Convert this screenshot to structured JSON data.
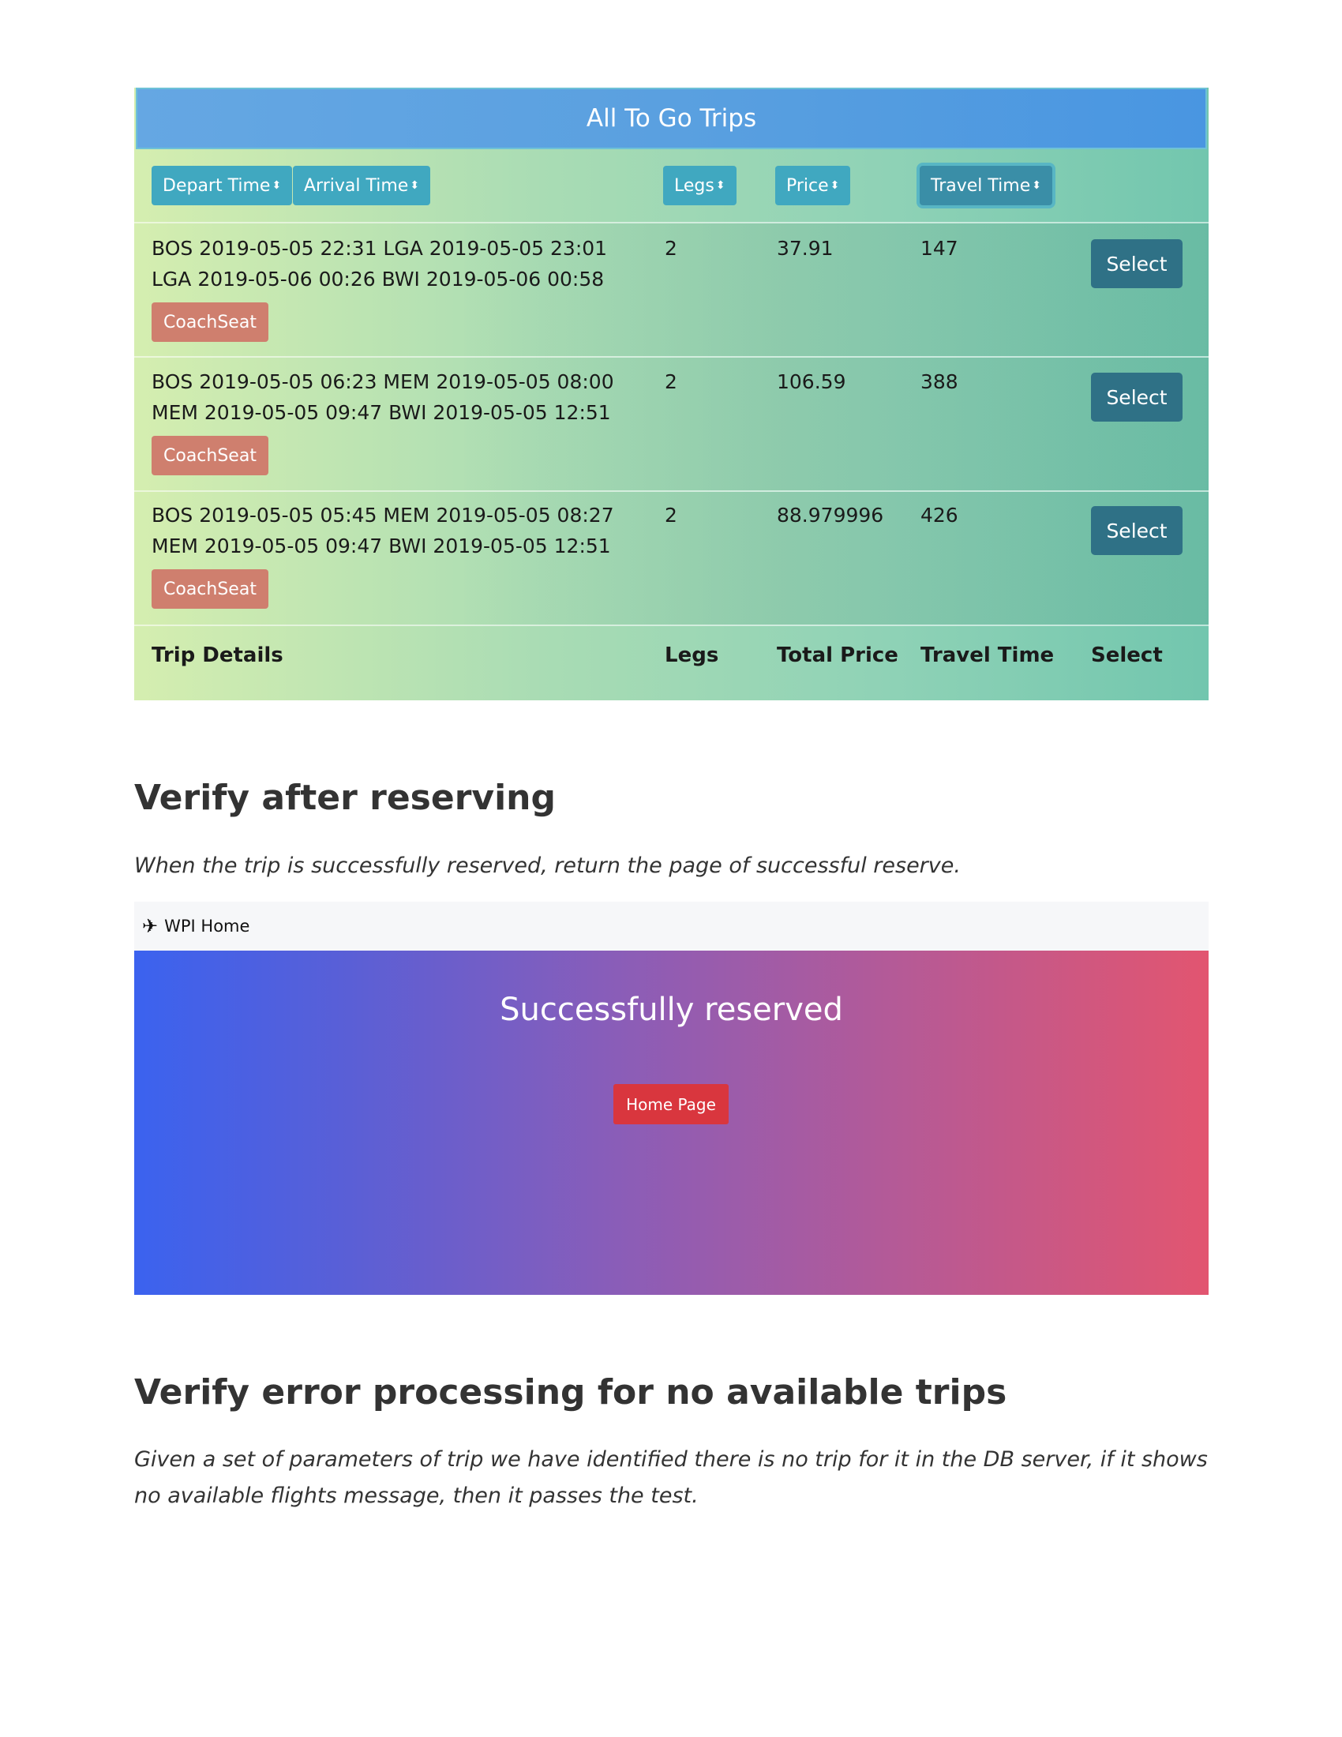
{
  "trips_table": {
    "title": "All To Go Trips",
    "sort_buttons": [
      {
        "label": "Depart Time",
        "active": false
      },
      {
        "label": "Arrival Time",
        "active": false
      },
      {
        "label": "Legs",
        "active": false
      },
      {
        "label": "Price",
        "active": false
      },
      {
        "label": "Travel Time",
        "active": true
      }
    ],
    "sort_caret": "⬍",
    "rows": [
      {
        "line1": "BOS 2019-05-05 22:31 LGA 2019-05-05 23:01",
        "line2": "LGA 2019-05-06 00:26 BWI 2019-05-06 00:58",
        "seat": "CoachSeat",
        "legs": "2",
        "price": "37.91",
        "travel_time": "147",
        "select": "Select"
      },
      {
        "line1": "BOS 2019-05-05 06:23 MEM 2019-05-05 08:00",
        "line2": "MEM 2019-05-05 09:47 BWI 2019-05-05 12:51",
        "seat": "CoachSeat",
        "legs": "2",
        "price": "106.59",
        "travel_time": "388",
        "select": "Select"
      },
      {
        "line1": "BOS 2019-05-05 05:45 MEM 2019-05-05 08:27",
        "line2": "MEM 2019-05-05 09:47 BWI 2019-05-05 12:51",
        "seat": "CoachSeat",
        "legs": "2",
        "price": "88.979996",
        "travel_time": "426",
        "select": "Select"
      }
    ],
    "footer": {
      "trip_details": "Trip Details",
      "legs": "Legs",
      "total_price": "Total Price",
      "travel_time": "Travel Time",
      "select": "Select"
    }
  },
  "section_reserve": {
    "heading": "Verify after reserving",
    "body": "When the trip is successfully reserved, return the page of successful reserve."
  },
  "success_page": {
    "brand": "WPI Home",
    "brand_icon": "airplane-icon",
    "title": "Successfully reserved",
    "button": "Home Page"
  },
  "section_error": {
    "heading": "Verify error processing for no available trips",
    "body": "Given a set of parameters of trip we have identified there is no trip for it in the DB server, if it shows no available flights message, then it passes the test."
  },
  "colors": {
    "header_blue": "#5aa0e0",
    "sort_button": "#40a8c0",
    "select_button": "#2f7186",
    "seat_badge": "#cf7f6e",
    "home_button": "#d9363e"
  }
}
